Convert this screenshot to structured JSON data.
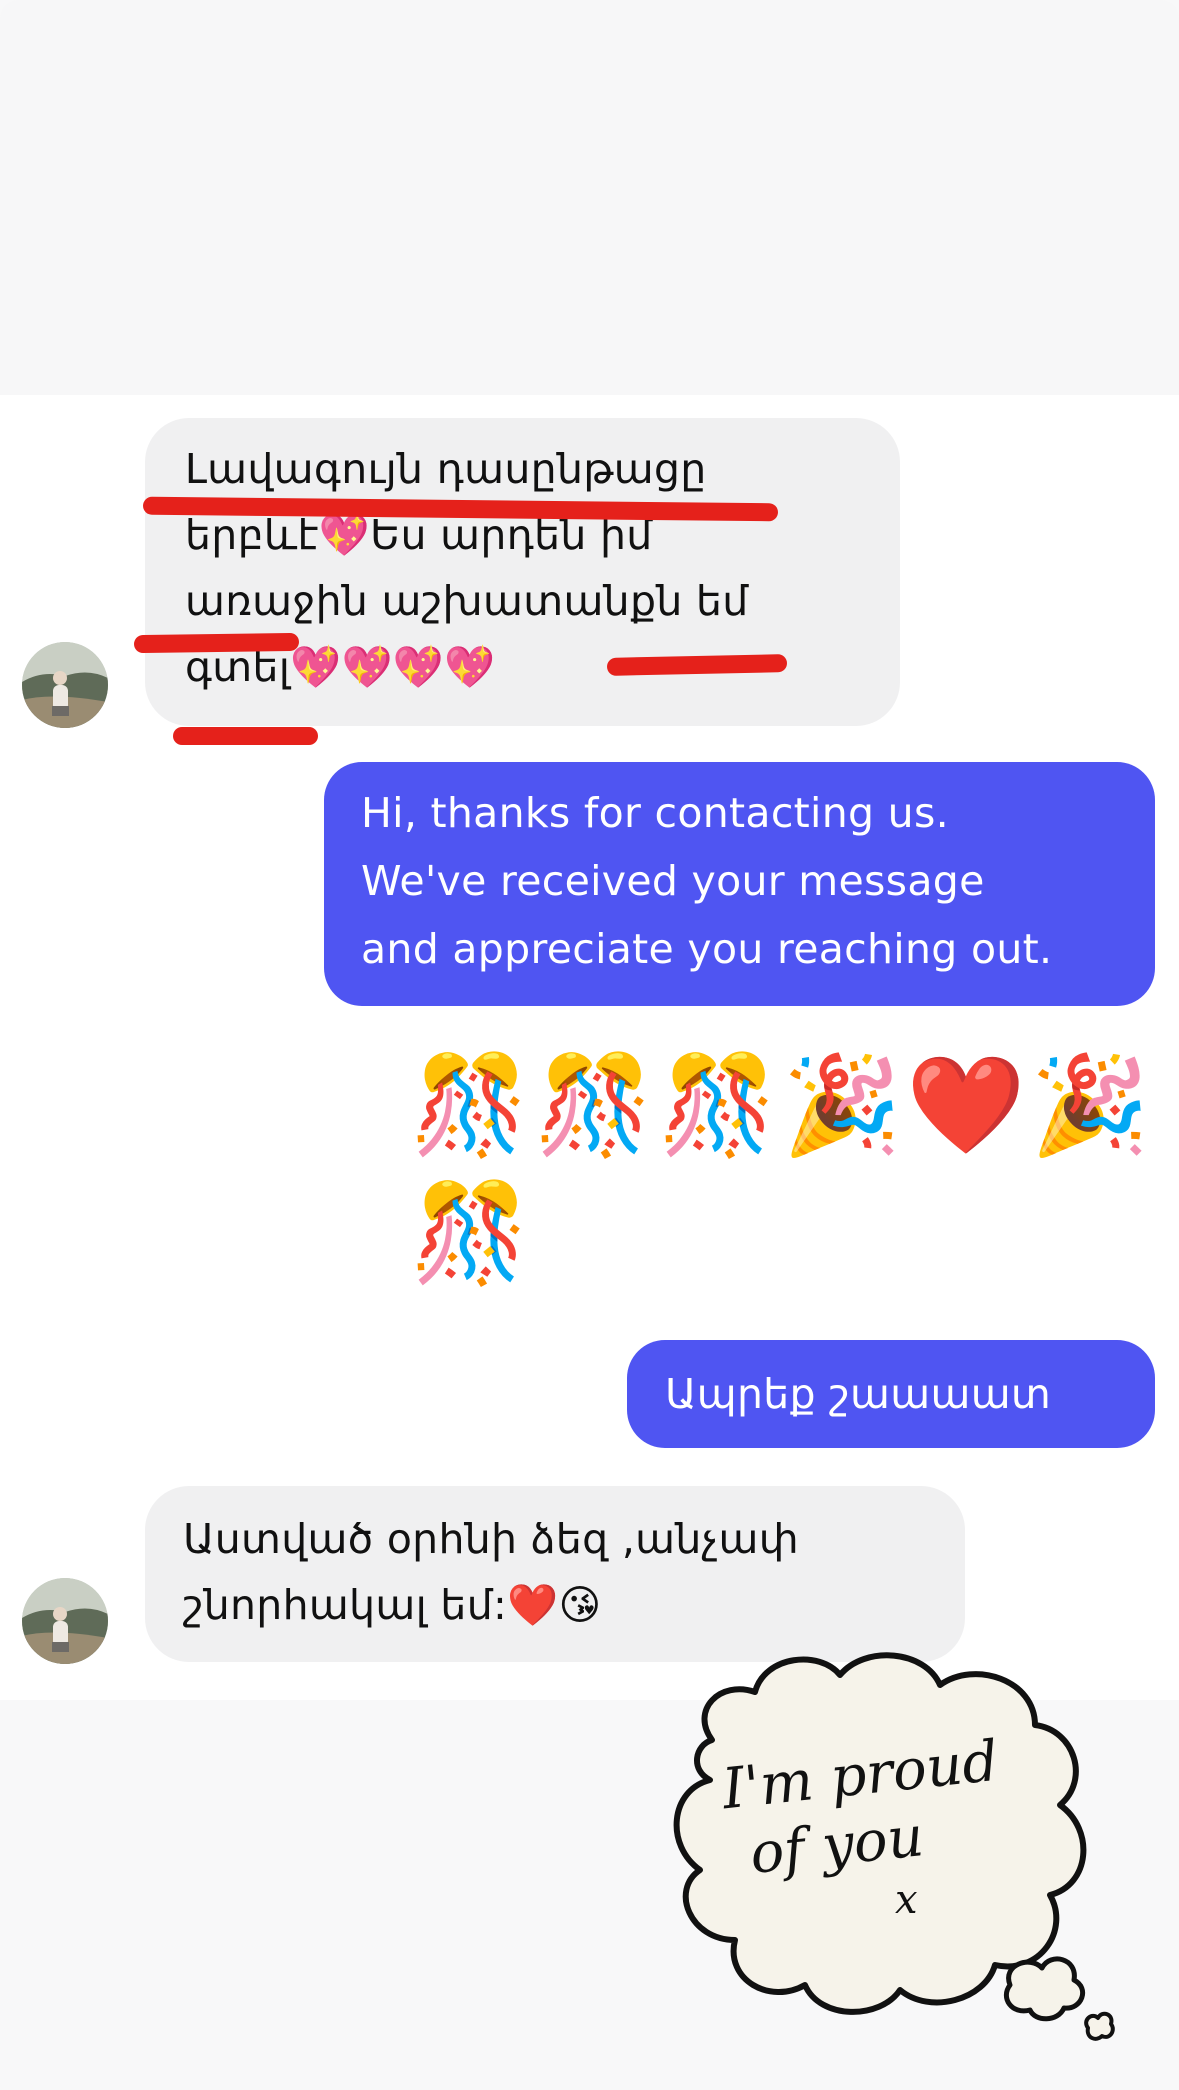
{
  "messages": [
    {
      "id": "m1",
      "direction": "incoming",
      "lines": [
        "Լավագույն դասընթացը",
        "երբևէ💖Ես արդեն իմ",
        "առաջին  աշխատանքն եմ",
        "գտել💖💖💖💖"
      ]
    },
    {
      "id": "m2",
      "direction": "outgoing",
      "lines": [
        "Hi, thanks for contacting us.",
        "We've received your message",
        "and appreciate you reaching out."
      ]
    },
    {
      "id": "m3",
      "direction": "outgoing-emoji",
      "emojis": [
        "🎊",
        "🎊",
        "🎊",
        "🎉",
        "❤️",
        "🎉",
        "🎊"
      ]
    },
    {
      "id": "m4",
      "direction": "outgoing",
      "lines": [
        "Ապրեք շաաաատ"
      ]
    },
    {
      "id": "m5",
      "direction": "incoming",
      "lines": [
        "Աստված օրհնի ձեզ  ,անչափ",
        "շնորհակալ եմ:❤️😘"
      ]
    }
  ],
  "sticker": {
    "lines": [
      "I'm proud",
      "of you",
      "x"
    ]
  },
  "colors": {
    "outgoing_bubble": "#4f55f2",
    "incoming_bubble": "#f0f0f1",
    "highlight_marks": "#e5211b"
  }
}
